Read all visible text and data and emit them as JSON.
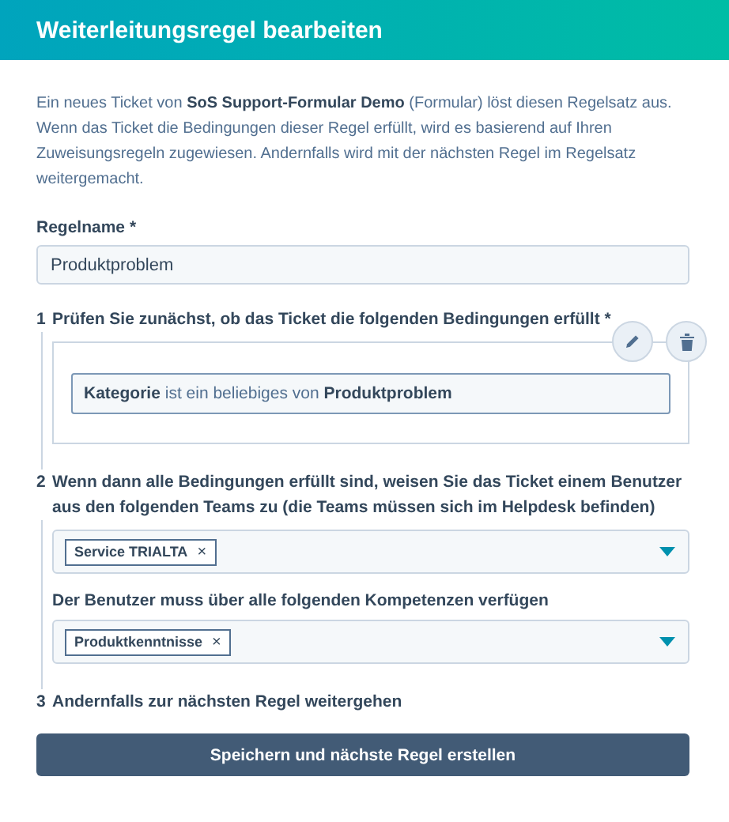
{
  "header": {
    "title": "Weiterleitungsregel bearbeiten"
  },
  "intro": "Ein neues Ticket von **SoS Support-Formular Demo** (Formular) löst diesen Regelsatz aus. Wenn das Ticket die Bedingungen dieser Regel erfüllt, wird es basierend auf Ihren Zuweisungsregeln zugewiesen. Andernfalls wird mit der nächsten Regel im Regelsatz weitergemacht.",
  "rule_name": {
    "label": "Regelname *",
    "value": "Produktproblem"
  },
  "steps": [
    {
      "number": "1",
      "kind": "conditions",
      "text": "Prüfen Sie zunächst, ob das Ticket die folgenden Bedingungen erfüllt *",
      "condition": "**Kategorie** ist ein beliebiges von **Produktproblem**"
    },
    {
      "number": "2",
      "kind": "assign",
      "text": "Wenn dann alle Bedingungen erfüllt sind, weisen Sie das Ticket einem Benutzer aus den folgenden Teams zu (die Teams müssen sich im Helpdesk befinden)",
      "teams": [
        {
          "label": "Service TRIALTA",
          "remove": "×"
        }
      ],
      "skills_label": "Der Benutzer muss über alle folgenden Kompetenzen verfügen",
      "skills": [
        {
          "label": "Produktkenntnisse",
          "remove": "×"
        }
      ]
    },
    {
      "number": "3",
      "kind": "plain",
      "text": "Andernfalls zur nächsten Regel weitergehen"
    }
  ],
  "button": "Speichern und nächste Regel erstellen"
}
